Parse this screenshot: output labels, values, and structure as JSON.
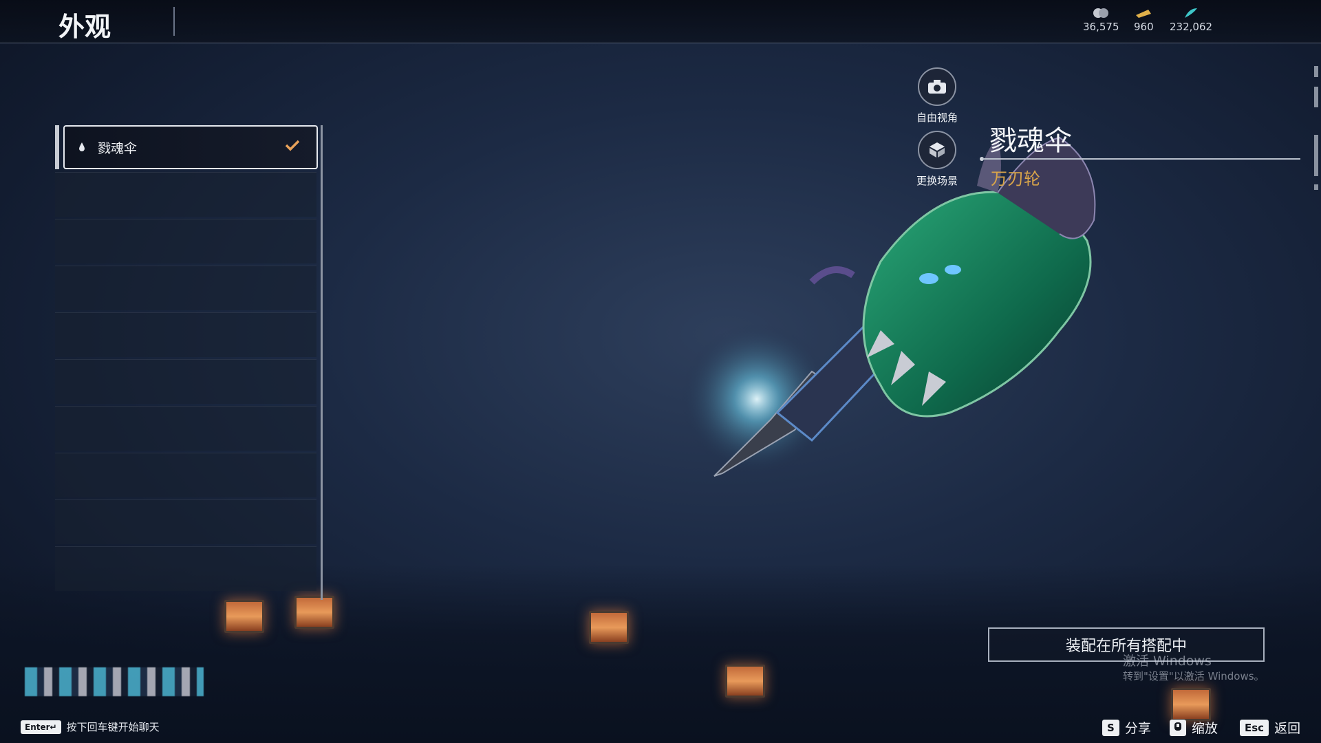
{
  "header": {
    "title": "外观",
    "currencies": [
      {
        "icon": "coin-stack-icon",
        "value": "36,575"
      },
      {
        "icon": "gold-ticket-icon",
        "value": "960"
      },
      {
        "icon": "jade-feather-icon",
        "value": "232,062"
      }
    ]
  },
  "skin_list": {
    "items": [
      {
        "name": "戮魂伞",
        "selected": true,
        "icon": "droplet-icon",
        "status_icon": "checkmark-icon"
      }
    ]
  },
  "camera_controls": {
    "free_view_label": "自由视角",
    "change_scene_label": "更换场景"
  },
  "item_detail": {
    "name": "戮魂伞",
    "type": "万刃轮"
  },
  "equip_button_label": "装配在所有搭配中",
  "windows_watermark": {
    "line1": "激活 Windows",
    "line2": "转到\"设置\"以激活 Windows。"
  },
  "chat_hint": {
    "key": "Enter↵",
    "text": "按下回车键开始聊天"
  },
  "actions": [
    {
      "key": "S",
      "label": "分享"
    },
    {
      "key": "zoom-icon",
      "label": "缩放"
    },
    {
      "key": "Esc",
      "label": "返回"
    }
  ],
  "colors": {
    "accent_gold": "#d9a54a",
    "check_orange": "#e8a25a"
  }
}
